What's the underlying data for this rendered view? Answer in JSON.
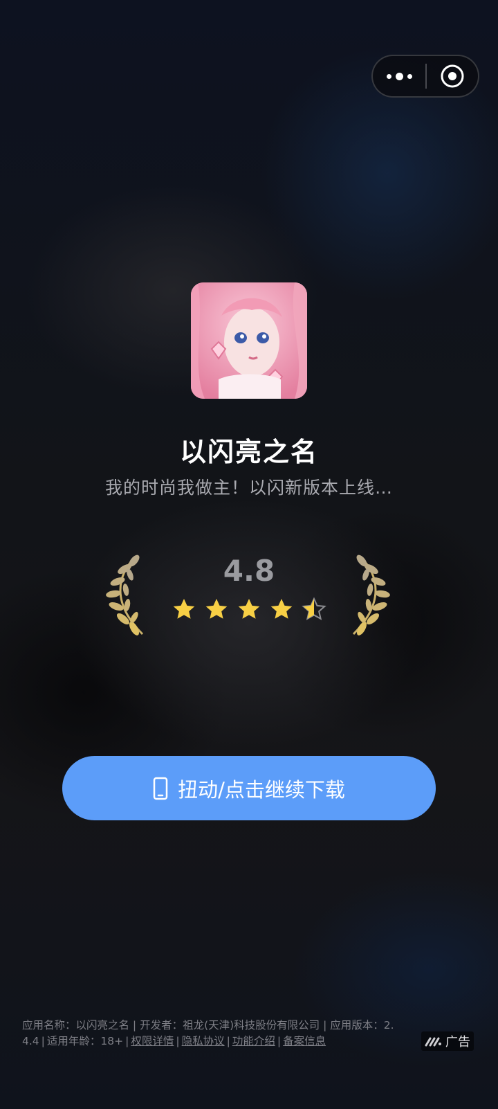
{
  "app": {
    "name": "以闪亮之名",
    "tagline": "我的时尚我做主！以闪新版本上线…"
  },
  "rating": {
    "score": "4.8",
    "stars_full": 4,
    "stars_half": 1,
    "stars_total": 5
  },
  "download_button": {
    "label": "扭动/点击继续下载",
    "icon": "phone-icon"
  },
  "capsule": {
    "more_icon": "more-dots-icon",
    "close_icon": "target-close-icon"
  },
  "footer": {
    "line1": "应用名称：以闪亮之名 | 开发者：祖龙(天津)科技股份有限公司 | 应用版本：2.",
    "version_tail": "4.4",
    "age_label": "适用年龄：18+",
    "links": [
      "权限详情",
      "隐私协议",
      "功能介绍",
      "备案信息"
    ],
    "separator": "|"
  },
  "ad_badge": {
    "label": "广告",
    "icon": "ad-logo-icon"
  },
  "colors": {
    "button": "#5c9df9",
    "star": "#f7cf45",
    "laurel": "#c9b06a"
  }
}
